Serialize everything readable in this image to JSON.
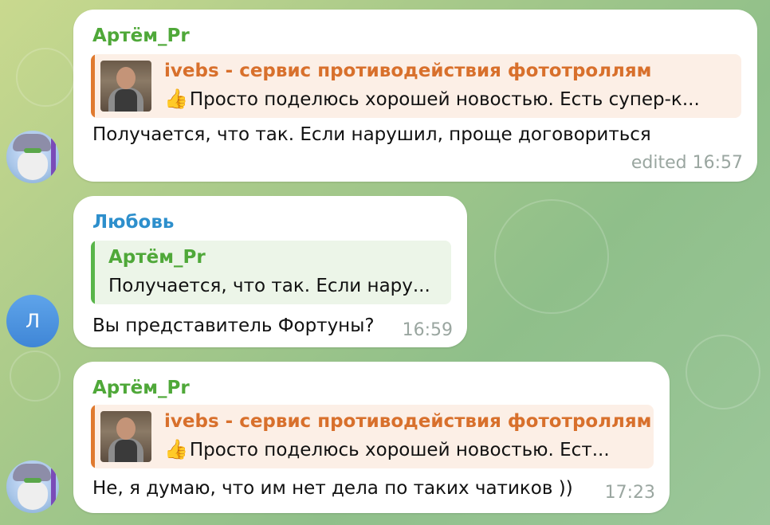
{
  "colors": {
    "artem_name": "#4fa839",
    "lubov_name": "#2d8fcc",
    "reply_orange_bg": "#fcefe6",
    "reply_orange_bar": "#e07a2f",
    "reply_orange_title": "#d8702c",
    "reply_green_bg": "#ecf5e8",
    "reply_green_bar": "#59b54a",
    "reply_green_title": "#4fa839",
    "meta": "#9aa6a0"
  },
  "messages": [
    {
      "sender": "Артём_Pr",
      "reply": {
        "title": "ivebs - сервис противодействия фототроллям",
        "emoji": "👍",
        "text": "Просто поделюсь хорошей новостью. Есть супер-к..."
      },
      "text": "Получается, что так. Если нарушил, проще договориться",
      "meta": "edited 16:57",
      "avatar_icon": "wizard-avatar-icon"
    },
    {
      "sender": "Любовь",
      "reply": {
        "title": "Артём_Pr",
        "text": "Получается, что так. Если нару..."
      },
      "text": "Вы представитель Фортуны?",
      "meta": "16:59",
      "avatar_letter": "Л"
    },
    {
      "sender": "Артём_Pr",
      "reply": {
        "title": "ivebs - сервис противодействия фототроллям",
        "emoji": "👍",
        "text": "Просто поделюсь хорошей новостью. Ест..."
      },
      "text": "Не, я думаю, что им нет дела по таких чатиков ))",
      "meta": "17:23",
      "avatar_icon": "wizard-avatar-icon"
    }
  ]
}
